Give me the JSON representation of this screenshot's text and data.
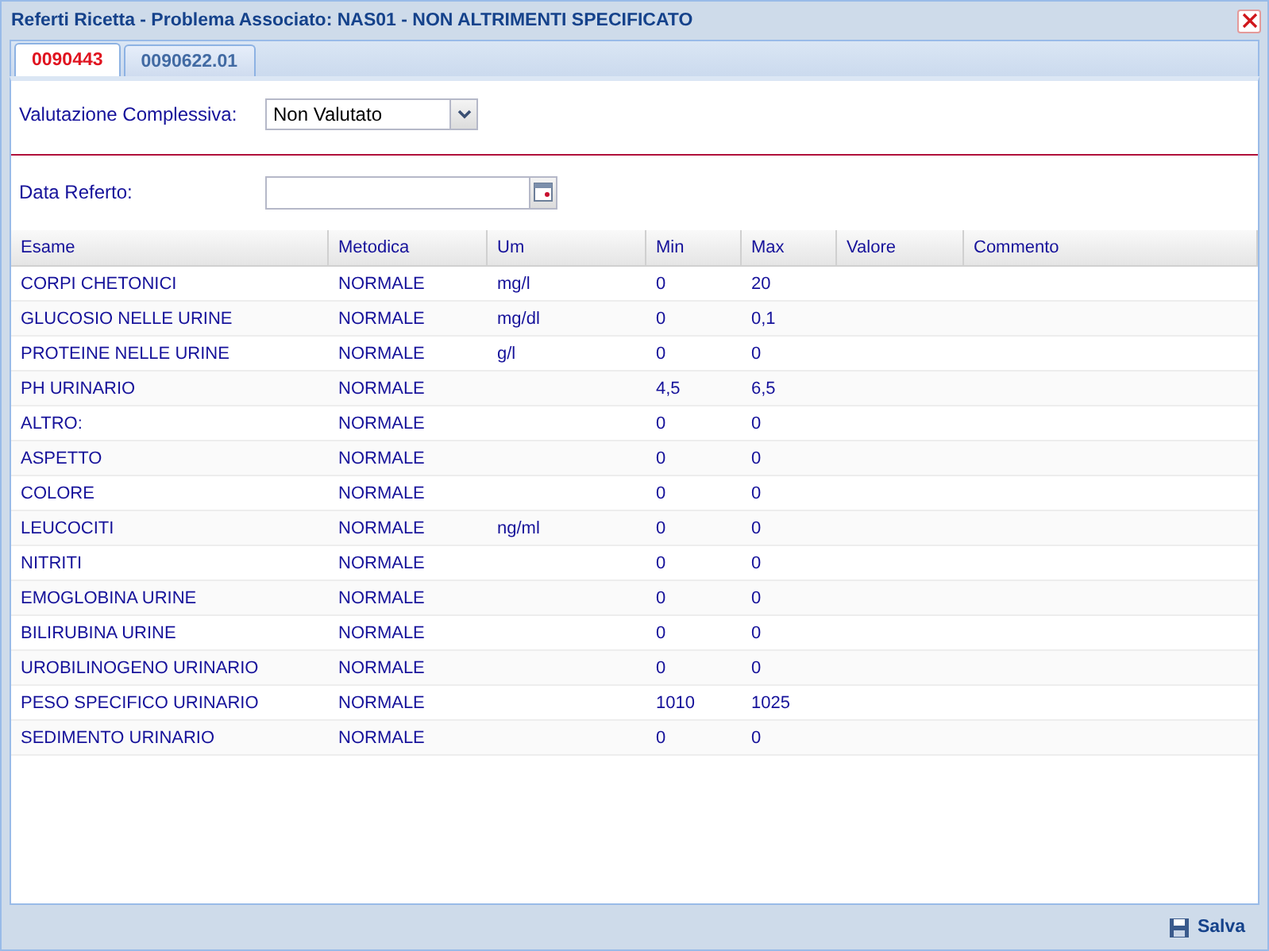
{
  "window": {
    "title": "Referti Ricetta - Problema Associato: NAS01 - NON ALTRIMENTI SPECIFICATO"
  },
  "tabs": [
    {
      "label": "0090443",
      "selected": true
    },
    {
      "label": "0090622.01",
      "selected": false
    }
  ],
  "valutazione": {
    "label": "Valutazione Complessiva:",
    "value": "Non Valutato"
  },
  "data_referto": {
    "label": "Data Referto:"
  },
  "table": {
    "columns": [
      "Esame",
      "Metodica",
      "Um",
      "Min",
      "Max",
      "Valore",
      "Commento"
    ],
    "rows": [
      [
        "CORPI CHETONICI",
        "NORMALE",
        "mg/l",
        "0",
        "20"
      ],
      [
        "GLUCOSIO NELLE URINE",
        "NORMALE",
        "mg/dl",
        "0",
        "0,1"
      ],
      [
        "PROTEINE NELLE URINE",
        "NORMALE",
        "g/l",
        "0",
        "0"
      ],
      [
        "PH URINARIO",
        "NORMALE",
        "",
        "4,5",
        "6,5"
      ],
      [
        "ALTRO:",
        "NORMALE",
        "",
        "0",
        "0"
      ],
      [
        "ASPETTO",
        "NORMALE",
        "",
        "0",
        "0"
      ],
      [
        "COLORE",
        "NORMALE",
        "",
        "0",
        "0"
      ],
      [
        "LEUCOCITI",
        "NORMALE",
        "ng/ml",
        "0",
        "0"
      ],
      [
        "NITRITI",
        "NORMALE",
        "",
        "0",
        "0"
      ],
      [
        "EMOGLOBINA URINE",
        "NORMALE",
        "",
        "0",
        "0"
      ],
      [
        "BILIRUBINA URINE",
        "NORMALE",
        "",
        "0",
        "0"
      ],
      [
        "UROBILINOGENO URINARIO",
        "NORMALE",
        "",
        "0",
        "0"
      ],
      [
        "PESO SPECIFICO URINARIO",
        "NORMALE",
        "",
        "1010",
        "1025"
      ],
      [
        "SEDIMENTO URINARIO",
        "NORMALE",
        "",
        "0",
        "0"
      ]
    ]
  },
  "footer": {
    "save_label": "Salva"
  }
}
